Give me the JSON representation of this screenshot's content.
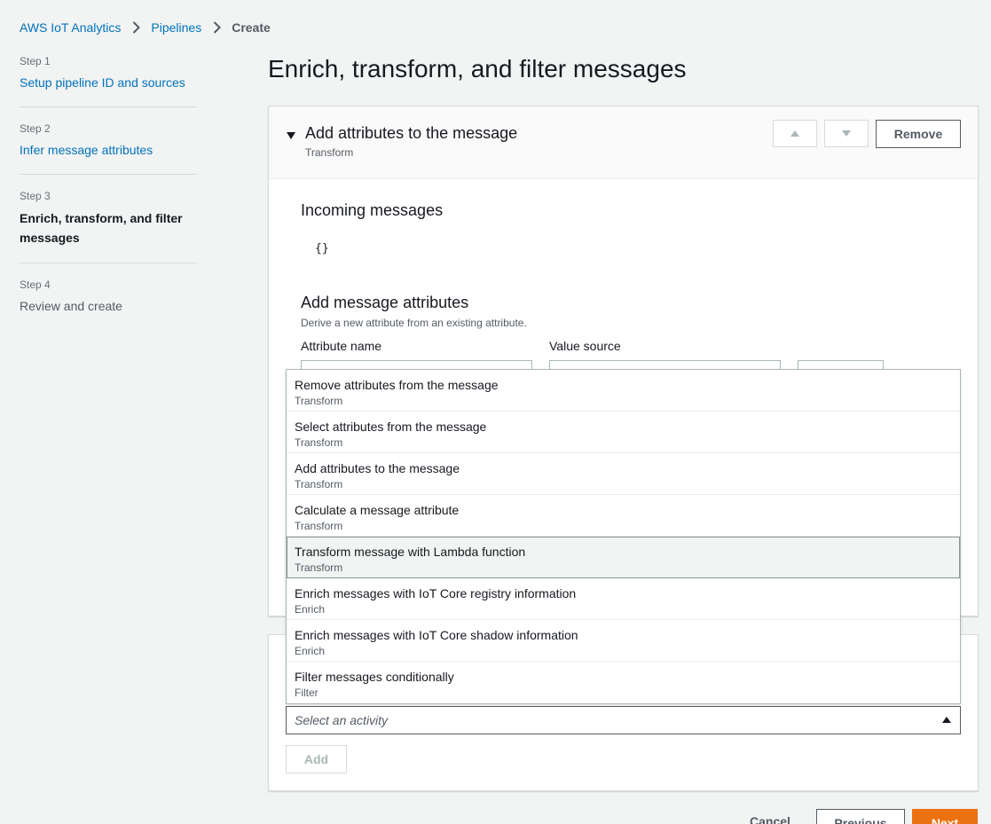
{
  "breadcrumb": {
    "items": [
      "AWS IoT Analytics",
      "Pipelines"
    ],
    "current": "Create"
  },
  "steps": [
    {
      "label": "Step 1",
      "title": "Setup pipeline ID and sources",
      "state": "link"
    },
    {
      "label": "Step 2",
      "title": "Infer message attributes",
      "state": "link"
    },
    {
      "label": "Step 3",
      "title": "Enrich, transform, and filter messages",
      "state": "active"
    },
    {
      "label": "Step 4",
      "title": "Review and create",
      "state": "disabled"
    }
  ],
  "page": {
    "title": "Enrich, transform, and filter messages"
  },
  "activity_panel": {
    "title": "Add attributes to the message",
    "subtitle": "Transform",
    "remove_label": "Remove",
    "incoming_heading": "Incoming messages",
    "incoming_code": "{}",
    "attributes_heading": "Add message attributes",
    "attributes_desc": "Derive a new attribute from an existing attribute.",
    "attribute_name_label": "Attribute name",
    "value_source_label": "Value source"
  },
  "dropdown": {
    "options": [
      {
        "title": "Remove attributes from the message",
        "category": "Transform"
      },
      {
        "title": "Select attributes from the message",
        "category": "Transform"
      },
      {
        "title": "Add attributes to the message",
        "category": "Transform"
      },
      {
        "title": "Calculate a message attribute",
        "category": "Transform"
      },
      {
        "title": "Transform message with Lambda function",
        "category": "Transform"
      },
      {
        "title": "Enrich messages with IoT Core registry information",
        "category": "Enrich"
      },
      {
        "title": "Enrich messages with IoT Core shadow information",
        "category": "Enrich"
      },
      {
        "title": "Filter messages conditionally",
        "category": "Filter"
      }
    ],
    "highlighted_index": 4,
    "placeholder": "Select an activity"
  },
  "add_label": "Add",
  "footer": {
    "cancel_label": "Cancel",
    "previous_label": "Previous",
    "next_label": "Next"
  },
  "colors": {
    "link": "#0073bb",
    "primary": "#ec7211",
    "background": "#f2f3f3",
    "border": "#d5dbdb"
  },
  "icons": [
    "chevron-right-icon",
    "caret-down-icon",
    "arrow-up-icon",
    "arrow-down-icon",
    "caret-up-icon"
  ]
}
